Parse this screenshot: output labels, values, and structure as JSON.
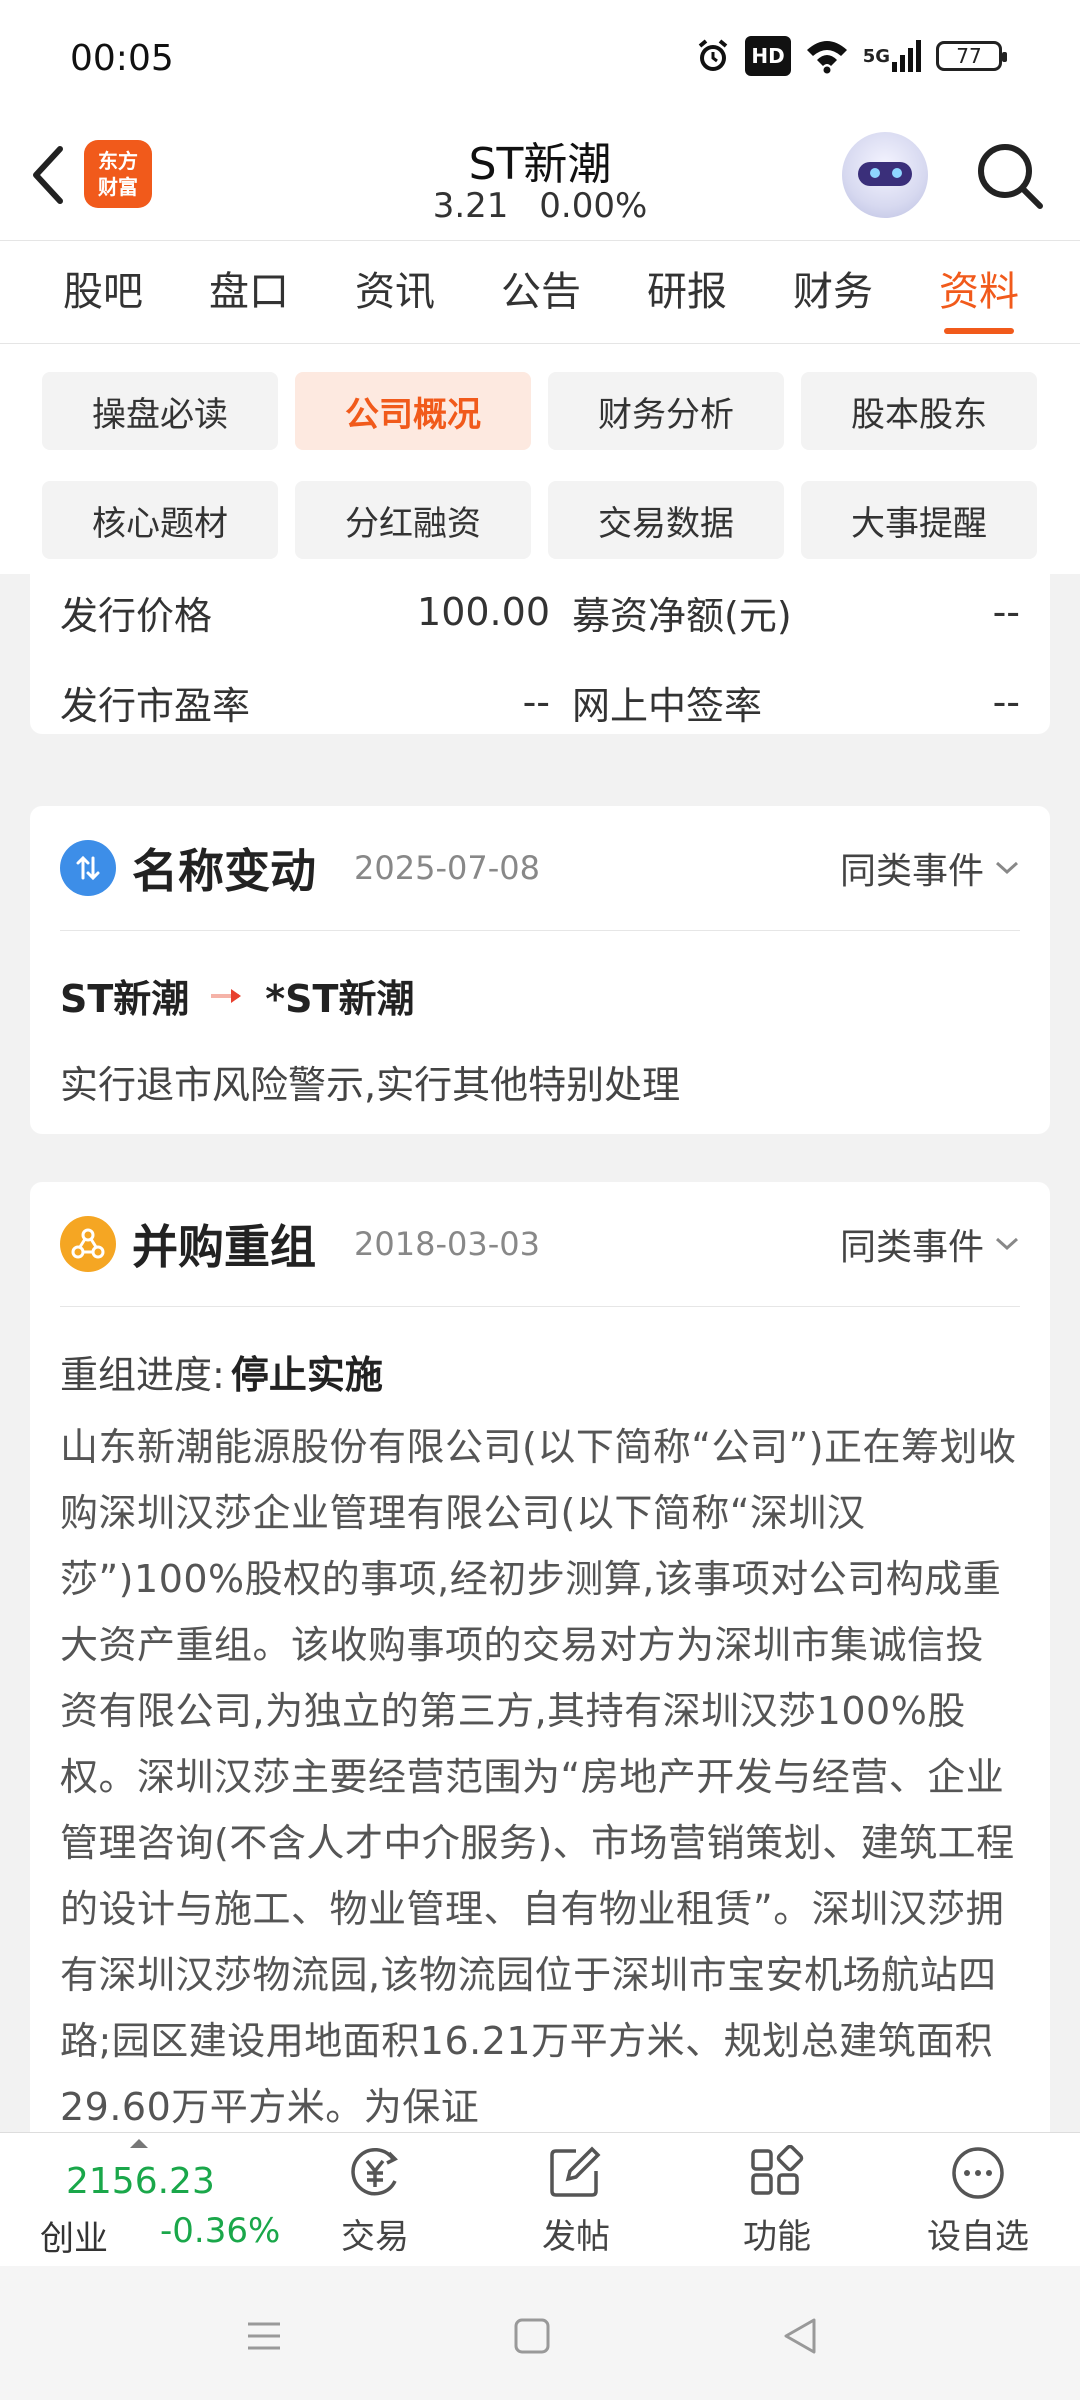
{
  "status": {
    "time": "00:05",
    "hd": "HD",
    "network": "5G",
    "battery": "77",
    "icons": [
      "alarm-icon",
      "wifi-icon",
      "signal-icon"
    ]
  },
  "header": {
    "logo_line1": "东方",
    "logo_line2": "财富",
    "title": "ST新潮",
    "price": "3.21",
    "change_pct": "0.00%"
  },
  "tabs": [
    "股吧",
    "盘口",
    "资讯",
    "公告",
    "研报",
    "财务",
    "资料"
  ],
  "active_tab": "资料",
  "chips": [
    "操盘必读",
    "公司概况",
    "财务分析",
    "股本股东",
    "核心题材",
    "分红融资",
    "交易数据",
    "大事提醒"
  ],
  "active_chip": "公司概况",
  "ipo": {
    "rows": [
      {
        "label_a": "发行价格",
        "value_a": "100.00",
        "label_b": "募资净额(元)",
        "value_b": "--"
      },
      {
        "label_a": "发行市盈率",
        "value_a": "--",
        "label_b": "网上中签率",
        "value_b": "--"
      }
    ]
  },
  "rename_event": {
    "title": "名称变动",
    "date": "2025-07-08",
    "more": "同类事件",
    "old_name": "ST新潮",
    "new_name": "*ST新潮",
    "description": "实行退市风险警示,实行其他特别处理"
  },
  "merge_event": {
    "title": "并购重组",
    "date": "2018-03-03",
    "more": "同类事件",
    "progress_label": "重组进度:",
    "progress_value": "停止实施",
    "body": "山东新潮能源股份有限公司(以下简称“公司”)正在筹划收购深圳汉莎企业管理有限公司(以下简称“深圳汉莎”)100%股权的事项,经初步测算,该事项对公司构成重大资产重组。该收购事项的交易对方为深圳市集诚信投资有限公司,为独立的第三方,其持有深圳汉莎100%股权。深圳汉莎主要经营范围为“房地产开发与经营、企业管理咨询(不含人才中介服务)、市场营销策划、建筑工程的设计与施工、物业管理、自有物业租赁”。深圳汉莎拥有深圳汉莎物流园,该物流园位于深圳市宝安机场航站四路;园区建设用地面积16.21万平方米、规划总建筑面积29.60万平方米。为保证"
  },
  "toolbar": {
    "index_value": "2156.23",
    "index_name": "创业",
    "index_change": "-0.36%",
    "trade": "交易",
    "post": "发帖",
    "functions": "功能",
    "watchlist": "设自选"
  },
  "colors": {
    "accent": "#f15a1b",
    "down_green": "#1aa74a",
    "rename_icon": "#3d8ee8",
    "merge_icon": "#f5a623"
  }
}
